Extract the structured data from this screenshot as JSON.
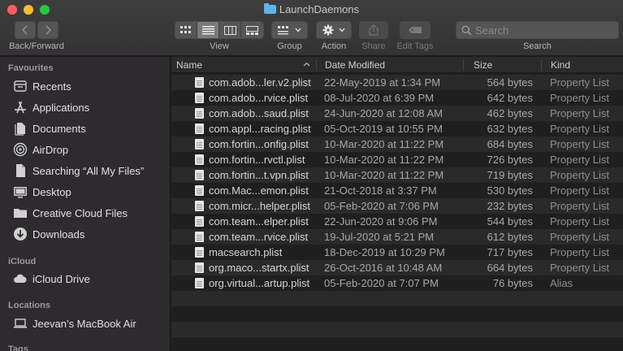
{
  "window": {
    "title": "LaunchDaemons"
  },
  "toolbar": {
    "back_forward_label": "Back/Forward",
    "view_label": "View",
    "group_label": "Group",
    "action_label": "Action",
    "share_label": "Share",
    "edit_tags_label": "Edit Tags",
    "search_label": "Search",
    "search_placeholder": "Search"
  },
  "sidebar": {
    "favourites_header": "Favourites",
    "favourites": [
      {
        "label": "Recents",
        "icon": "recents-icon"
      },
      {
        "label": "Applications",
        "icon": "applications-icon"
      },
      {
        "label": "Documents",
        "icon": "documents-icon"
      },
      {
        "label": "AirDrop",
        "icon": "airdrop-icon"
      },
      {
        "label": "Searching “All My Files”",
        "icon": "document-icon"
      },
      {
        "label": "Desktop",
        "icon": "desktop-icon"
      },
      {
        "label": "Creative Cloud Files",
        "icon": "folder-icon"
      },
      {
        "label": "Downloads",
        "icon": "downloads-icon"
      }
    ],
    "icloud_header": "iCloud",
    "icloud": [
      {
        "label": "iCloud Drive",
        "icon": "cloud-icon"
      }
    ],
    "locations_header": "Locations",
    "locations": [
      {
        "label": "Jeevan’s MacBook Air",
        "icon": "laptop-icon"
      }
    ],
    "tags_header": "Tags"
  },
  "columns": {
    "name": "Name",
    "date": "Date Modified",
    "size": "Size",
    "kind": "Kind"
  },
  "files": [
    {
      "name": "com.adob...ler.v2.plist",
      "date": "22-May-2019 at 1:34 PM",
      "size": "564 bytes",
      "kind": "Property List"
    },
    {
      "name": "com.adob...rvice.plist",
      "date": "08-Jul-2020 at 6:39 PM",
      "size": "642 bytes",
      "kind": "Property List"
    },
    {
      "name": "com.adob...saud.plist",
      "date": "24-Jun-2020 at 12:08 AM",
      "size": "462 bytes",
      "kind": "Property List"
    },
    {
      "name": "com.appl...racing.plist",
      "date": "05-Oct-2019 at 10:55 PM",
      "size": "632 bytes",
      "kind": "Property List"
    },
    {
      "name": "com.fortin...onfig.plist",
      "date": "10-Mar-2020 at 11:22 PM",
      "size": "684 bytes",
      "kind": "Property List"
    },
    {
      "name": "com.fortin...rvctl.plist",
      "date": "10-Mar-2020 at 11:22 PM",
      "size": "726 bytes",
      "kind": "Property List"
    },
    {
      "name": "com.fortin...t.vpn.plist",
      "date": "10-Mar-2020 at 11:22 PM",
      "size": "719 bytes",
      "kind": "Property List"
    },
    {
      "name": "com.Mac...emon.plist",
      "date": "21-Oct-2018 at 3:37 PM",
      "size": "530 bytes",
      "kind": "Property List"
    },
    {
      "name": "com.micr...helper.plist",
      "date": "05-Feb-2020 at 7:06 PM",
      "size": "232 bytes",
      "kind": "Property List"
    },
    {
      "name": "com.team...elper.plist",
      "date": "22-Jun-2020 at 9:06 PM",
      "size": "544 bytes",
      "kind": "Property List"
    },
    {
      "name": "com.team...rvice.plist",
      "date": "19-Jul-2020 at 5:21 PM",
      "size": "612 bytes",
      "kind": "Property List"
    },
    {
      "name": "macsearch.plist",
      "date": "18-Dec-2019 at 10:29 PM",
      "size": "717 bytes",
      "kind": "Property List"
    },
    {
      "name": "org.maco...startx.plist",
      "date": "26-Oct-2016 at 10:48 AM",
      "size": "664 bytes",
      "kind": "Property List"
    },
    {
      "name": "org.virtual...artup.plist",
      "date": "05-Feb-2020 at 7:07 PM",
      "size": "76 bytes",
      "kind": "Alias"
    }
  ]
}
